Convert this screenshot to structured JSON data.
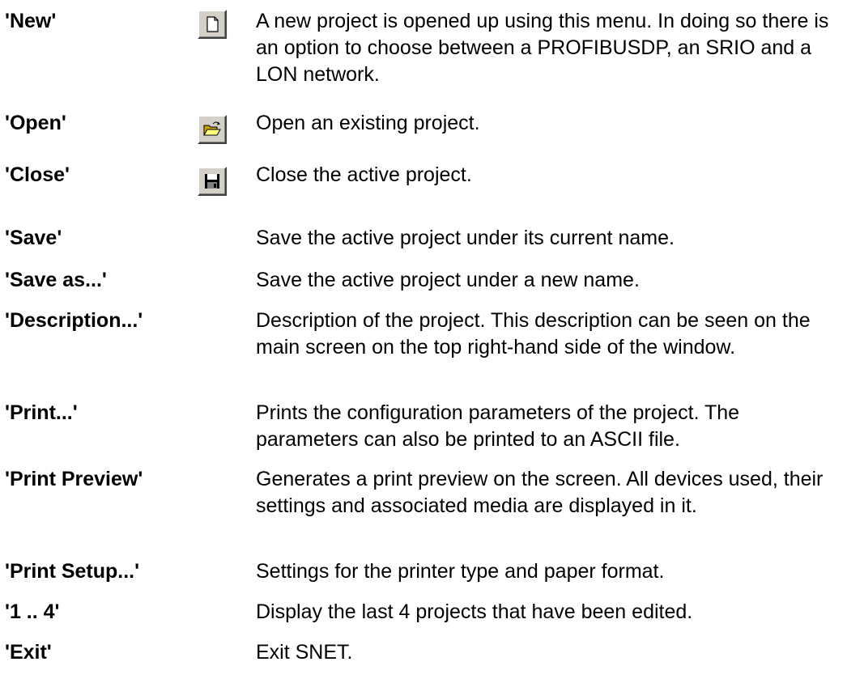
{
  "entries": [
    {
      "term": "'New'",
      "icon": "new-document-icon",
      "description": "A new project is opened up using this menu. In doing so there is an option to choose between a PROFIBUSDP, an SRIO and a LON network."
    },
    {
      "term": "'Open'",
      "icon": "open-folder-icon",
      "description": "Open an existing project."
    },
    {
      "term": "'Close'",
      "icon": "floppy-disk-icon",
      "description": "Close the active project."
    },
    {
      "term": "'Save'",
      "description": "Save the active project under its current name."
    },
    {
      "term": "'Save as...'",
      "description": "Save the active project under a new name."
    },
    {
      "term": "'Description...'",
      "description": "Description of the project. This description can be seen on the main screen on the top right-hand side of the window."
    },
    {
      "term": "'Print...'",
      "description": "Prints the configuration parameters of the project. The parameters can also be printed to an ASCII file."
    },
    {
      "term": "'Print Preview'",
      "description": "Generates a print preview on the screen. All devices used, their settings and associated media are displayed in it."
    },
    {
      "term": "'Print Setup...'",
      "description": "Settings for the printer type and paper format."
    },
    {
      "term": "'1 .. 4'",
      "description": "Display the last 4 projects that have been edited."
    },
    {
      "term": "'Exit'",
      "description": "Exit SNET."
    }
  ]
}
